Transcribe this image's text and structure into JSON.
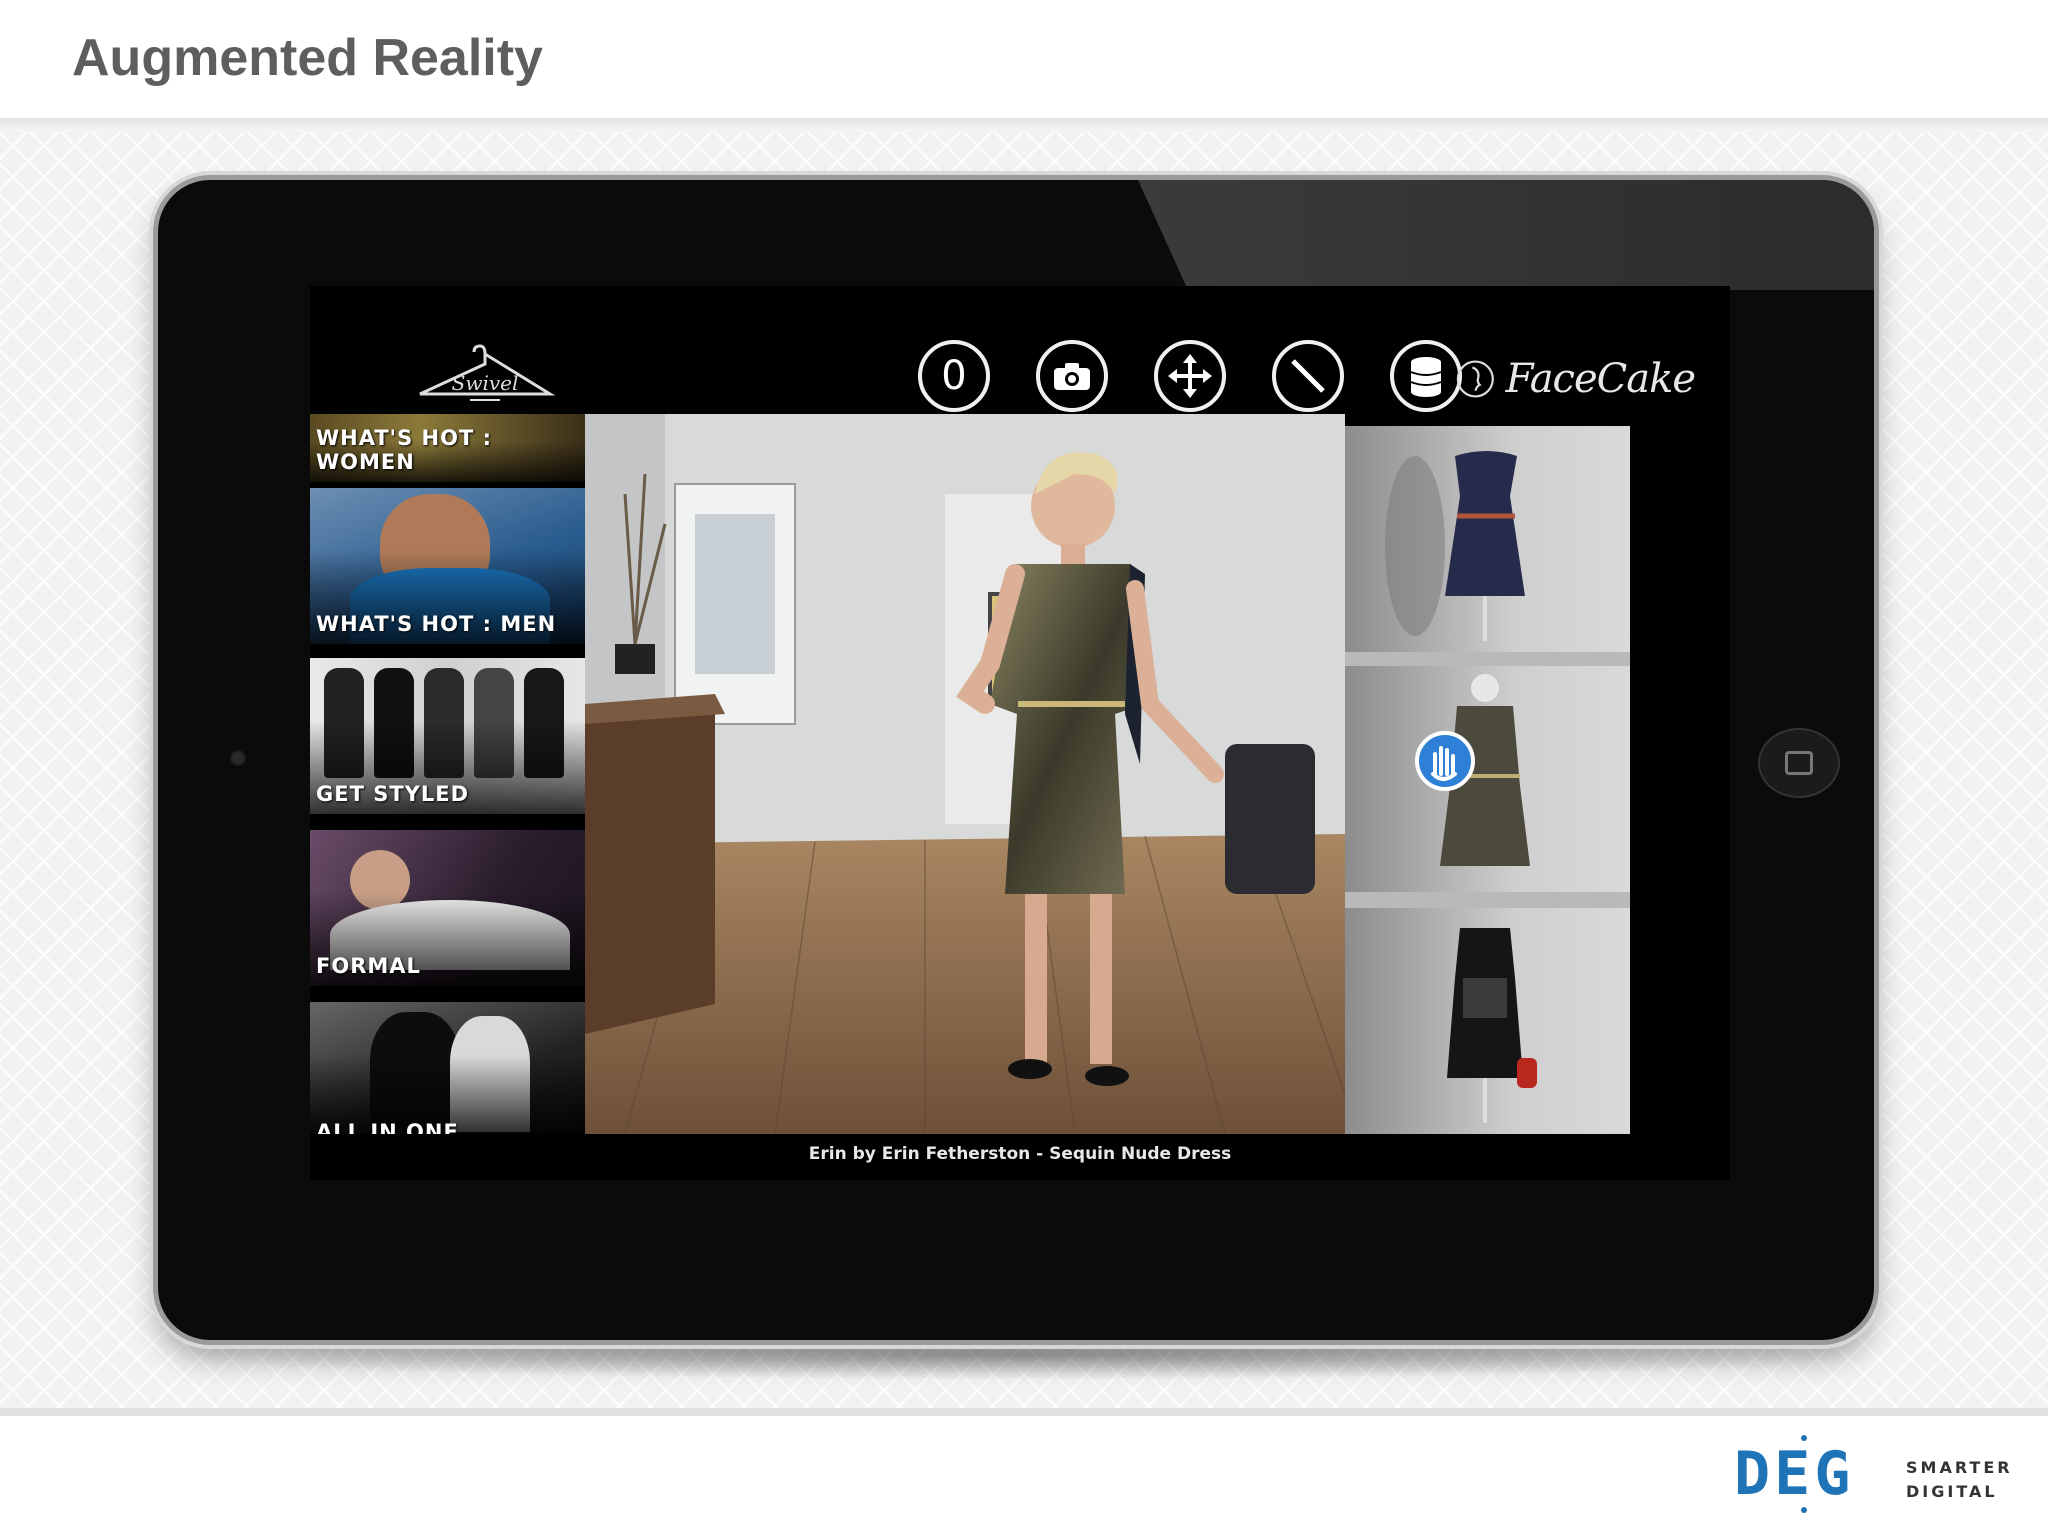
{
  "slide": {
    "title": "Augmented Reality"
  },
  "app": {
    "logo_text": "Swivel",
    "brand_text": "FaceCake",
    "toolbar": {
      "counter_value": "0",
      "icons": [
        "counter-icon",
        "camera-icon",
        "move-icon",
        "no-icon",
        "database-icon"
      ]
    },
    "categories": [
      {
        "label": "WHAT'S HOT : WOMEN"
      },
      {
        "label": "WHAT'S HOT : MEN"
      },
      {
        "label": "GET STYLED"
      },
      {
        "label": "FORMAL"
      },
      {
        "label": "ALL IN ONE"
      }
    ],
    "caption": "Erin by Erin Fetherston - Sequin Nude Dress"
  },
  "footer": {
    "logo_text": "DEG",
    "tagline_line1": "SMARTER",
    "tagline_line2": "DIGITAL"
  },
  "colors": {
    "title_gray": "#5e5e5e",
    "deg_blue": "#1f73b7",
    "cursor_blue": "#2e7fd6"
  }
}
